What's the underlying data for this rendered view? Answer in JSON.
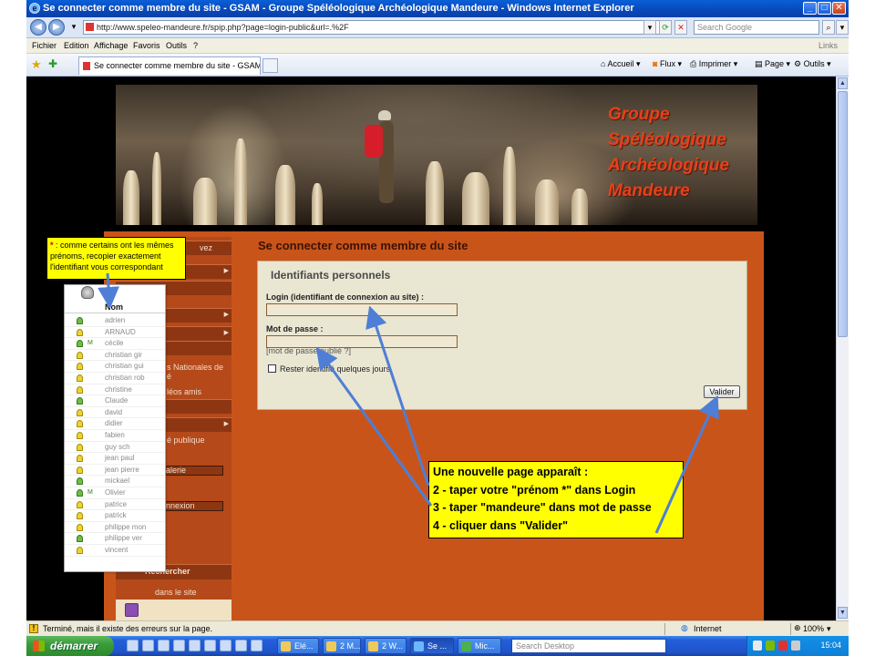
{
  "window": {
    "title": "Se connecter comme membre du site - GSAM - Groupe Spéléologique Archéologique Mandeure - Windows Internet Explorer"
  },
  "address_bar": {
    "url": "http://www.speleo-mandeure.fr/spip.php?page=login-public&url=.%2F",
    "search_placeholder": "Search Google"
  },
  "menu": {
    "items": [
      "Fichier",
      "Edition",
      "Affichage",
      "Favoris",
      "Outils",
      "?"
    ],
    "links_label": "Links"
  },
  "tab": {
    "title": "Se connecter comme membre du site - GSAM - Groupe..."
  },
  "commands": {
    "home": "Accueil",
    "feeds": "Flux",
    "print": "Imprimer",
    "page": "Page",
    "tools": "Outils"
  },
  "banner": {
    "line1": "Groupe",
    "line2": "Spéléologique",
    "line3": "Archéologique",
    "line4": "Mandeure"
  },
  "sidebar": {
    "row1": "vez",
    "text_nationales_1": "s Nationales de",
    "text_nationales_2": "é",
    "text_amis": "léos amis",
    "text_publique": "é publique",
    "input_galerie": "alerie",
    "input_connexion": "nnexion",
    "search_header": "Rechercher",
    "search_sub": "dans le site"
  },
  "main": {
    "title": "Se connecter comme membre du site",
    "form_title": "Identifiants personnels",
    "login_label": "Login (identifiant de connexion au site) :",
    "password_label": "Mot de passe :",
    "forgot": "[mot de passe oublié ?]",
    "remember": "Rester identifié quelques jours",
    "submit": "Valider"
  },
  "note_top": {
    "star": "*",
    "text": " : comme certains ont les mêmes prénoms, recopier exactement l'identifiant vous correspondant"
  },
  "names": {
    "header": "Nom",
    "online_tag": "M",
    "list": [
      {
        "name": "adrien",
        "color": "green",
        "online": false
      },
      {
        "name": "ARNAUD",
        "color": "yellow",
        "online": false
      },
      {
        "name": "cécile",
        "color": "green",
        "online": true
      },
      {
        "name": "christian gir",
        "color": "yellow",
        "online": false
      },
      {
        "name": "christian gui",
        "color": "yellow",
        "online": false
      },
      {
        "name": "christian rob",
        "color": "yellow",
        "online": false
      },
      {
        "name": "christine",
        "color": "yellow",
        "online": false
      },
      {
        "name": "Claude",
        "color": "green",
        "online": false
      },
      {
        "name": "david",
        "color": "yellow",
        "online": false
      },
      {
        "name": "didier",
        "color": "yellow",
        "online": false
      },
      {
        "name": "fabien",
        "color": "yellow",
        "online": false
      },
      {
        "name": "guy sch",
        "color": "yellow",
        "online": false
      },
      {
        "name": "jean paul",
        "color": "yellow",
        "online": false
      },
      {
        "name": "jean pierre",
        "color": "yellow",
        "online": false
      },
      {
        "name": "mickael",
        "color": "green",
        "online": false
      },
      {
        "name": "Olivier",
        "color": "green",
        "online": true
      },
      {
        "name": "patrice",
        "color": "yellow",
        "online": false
      },
      {
        "name": "patrick",
        "color": "yellow",
        "online": false
      },
      {
        "name": "philippe mon",
        "color": "yellow",
        "online": false
      },
      {
        "name": "philippe ver",
        "color": "green",
        "online": false
      },
      {
        "name": "vincent",
        "color": "yellow",
        "online": false
      }
    ]
  },
  "note_bottom": {
    "line1": "Une nouvelle page apparaît :",
    "line2": "2 - taper votre \"prénom *\" dans Login",
    "line3": "3 - taper \"mandeure\" dans mot de passe",
    "line4": "4 - cliquer dans \"Valider\""
  },
  "status": {
    "text": "Terminé, mais il existe des erreurs sur la page.",
    "zone": "Internet",
    "zoom": "100%"
  },
  "taskbar": {
    "start": "démarrer",
    "tasks": [
      "Elé...",
      "2 M...",
      "2 W...",
      "Se ...",
      "Mic..."
    ],
    "search_placeholder": "Search Desktop",
    "clock": "15:04"
  },
  "colors": {
    "page_orange": "#c9541a",
    "sidebar_dark": "#8e3612",
    "note_yellow": "#ffff00",
    "arrow_blue": "#4f7ed6"
  }
}
